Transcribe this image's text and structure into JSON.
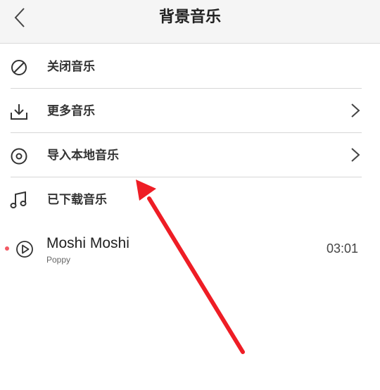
{
  "header": {
    "title": "背景音乐",
    "back_icon": "chevron-left-icon"
  },
  "menu": [
    {
      "label": "关闭音乐",
      "icon": "ban-circle-icon",
      "has_chevron": false
    },
    {
      "label": "更多音乐",
      "icon": "download-icon",
      "has_chevron": true
    },
    {
      "label": "导入本地音乐",
      "icon": "disc-icon",
      "has_chevron": true
    },
    {
      "label": "已下载音乐",
      "icon": "music-note-icon",
      "has_chevron": false
    }
  ],
  "downloaded": [
    {
      "title": "Moshi Moshi",
      "artist": "Poppy",
      "duration": "03:01"
    }
  ],
  "colors": {
    "annotation_arrow": "#ee1d25",
    "indicator_dot": "#f25a64"
  }
}
